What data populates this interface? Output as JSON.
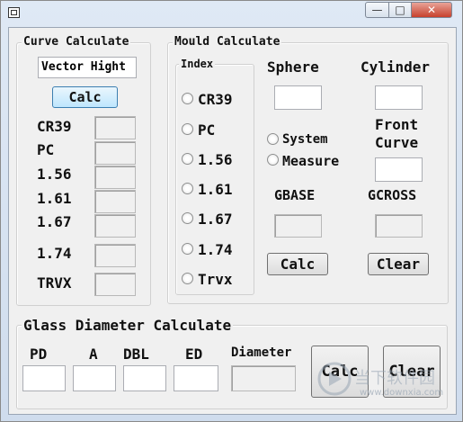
{
  "titlebar": {
    "minimize_glyph": "—",
    "maximize_glyph": "□",
    "close_glyph": "✕"
  },
  "curve": {
    "title": "Curve Calculate",
    "input_value": "Vector Hight",
    "calc_label": "Calc",
    "rows": [
      "CR39",
      "PC",
      "1.56",
      "1.61",
      "1.67",
      "1.74",
      "TRVX"
    ]
  },
  "mould": {
    "title": "Mould Calculate",
    "index_title": "Index",
    "index_options": [
      "CR39",
      "PC",
      "1.56",
      "1.61",
      "1.67",
      "1.74",
      "Trvx"
    ],
    "sphere_label": "Sphere",
    "cylinder_label": "Cylinder",
    "system_label": "System",
    "measure_label": "Measure",
    "front_curve_label_1": "Front",
    "front_curve_label_2": "Curve",
    "gbase_label": "GBASE",
    "gcross_label": "GCROSS",
    "calc_label": "Calc",
    "clear_label": "Clear"
  },
  "glass": {
    "title": "Glass Diameter Calculate",
    "pd_label": "PD",
    "a_label": "A",
    "dbl_label": "DBL",
    "ed_label": "ED",
    "diameter_label": "Diameter",
    "calc_label": "Calc",
    "clear_label": "Clear"
  },
  "watermark": {
    "cn": "当下软件园",
    "url": "www.downxia.com"
  }
}
